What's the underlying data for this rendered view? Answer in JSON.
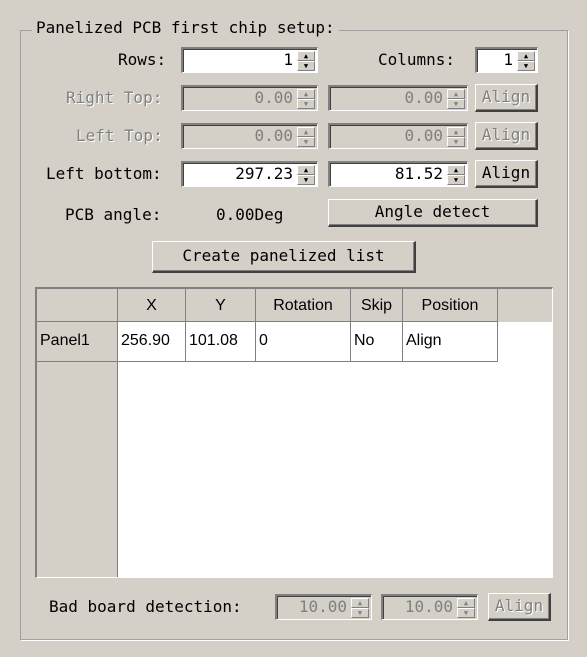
{
  "group": {
    "title": "Panelized PCB first chip setup:"
  },
  "rows": {
    "label": "Rows:",
    "value": "1"
  },
  "columns": {
    "label": "Columns:",
    "value": "1"
  },
  "right_top": {
    "label": "Right Top:",
    "x": "0.00",
    "y": "0.00",
    "align_label": "Align",
    "enabled": false
  },
  "left_top": {
    "label": "Left Top:",
    "x": "0.00",
    "y": "0.00",
    "align_label": "Align",
    "enabled": false
  },
  "left_bottom": {
    "label": "Left bottom:",
    "x": "297.23",
    "y": "81.52",
    "align_label": "Align",
    "enabled": true
  },
  "pcb_angle": {
    "label": "PCB angle:",
    "value": "0.00Deg",
    "detect_label": "Angle detect"
  },
  "create_list_label": "Create panelized list",
  "table": {
    "columns": [
      "X",
      "Y",
      "Rotation",
      "Skip",
      "Position"
    ],
    "rows": [
      {
        "name": "Panel1",
        "x": "256.90",
        "y": "101.08",
        "rotation": "0",
        "skip": "No",
        "position": "Align"
      }
    ]
  },
  "bad_board": {
    "label": "Bad board detection:",
    "x": "10.00",
    "y": "10.00",
    "align_label": "Align",
    "enabled": false
  }
}
